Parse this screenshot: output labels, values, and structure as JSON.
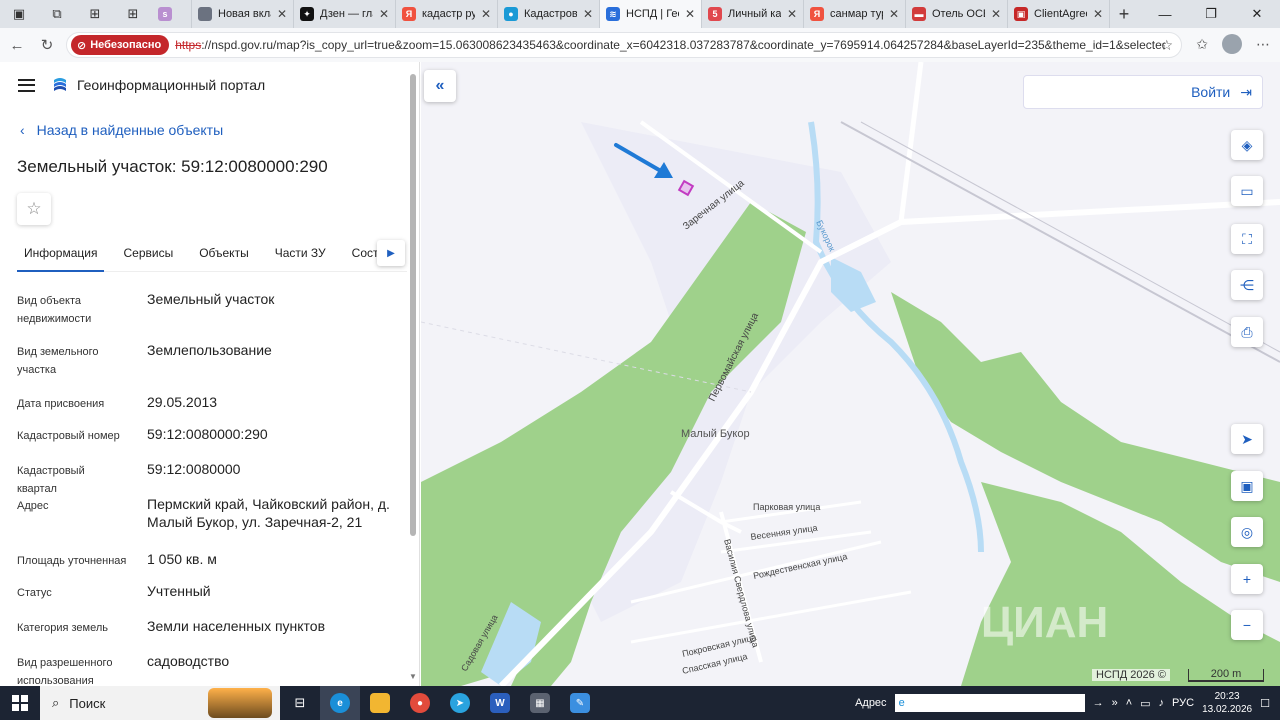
{
  "browser": {
    "tabs": [
      {
        "title": "",
        "favicon": "s",
        "color": "#b98fd0",
        "small": true
      },
      {
        "title": "Новая вкла",
        "favicon": "",
        "color": "#6b7280"
      },
      {
        "title": "Дзен — гла",
        "favicon": "✦",
        "color": "#111111"
      },
      {
        "title": "кадастр ру",
        "favicon": "Я",
        "color": "#f0523f"
      },
      {
        "title": "Кадастров",
        "favicon": "●",
        "color": "#1a9ad6"
      },
      {
        "title": "НСПД | Гео",
        "favicon": "≋",
        "color": "#2a6fdb",
        "active": true
      },
      {
        "title": "Личный ка",
        "favicon": "5",
        "color": "#e0484e"
      },
      {
        "title": "санмар тур",
        "favicon": "Я",
        "color": "#f0523f"
      },
      {
        "title": "Отель ОСЕ",
        "favicon": "▬",
        "color": "#d23b3b"
      },
      {
        "title": "ClientAgree",
        "favicon": "▣",
        "color": "#c62828"
      }
    ],
    "insecure_label": "Небезопасно",
    "url_scheme": "https",
    "url_rest": "://nspd.gov.ru/map?is_copy_url=true&zoom=15.063008623435463&coordinate_x=6042318.037283787&coordinate_y=7695914.064257284&baseLayerId=235&theme_id=1&selectedCa..."
  },
  "panel": {
    "portal_title": "Геоинформационный портал",
    "back_label": "Назад в найденные объекты",
    "object_title": "Земельный участок: 59:12:0080000:290",
    "tabs": [
      "Информация",
      "Сервисы",
      "Объекты",
      "Части ЗУ",
      "Соста"
    ],
    "rows": [
      {
        "key": "Вид объекта недвижимости",
        "value": "Земельный участок"
      },
      {
        "key": "Вид земельного участка",
        "value": "Землепользование"
      },
      {
        "key": "Дата присвоения",
        "value": "29.05.2013"
      },
      {
        "key": "Кадастровый номер",
        "value": "59:12:0080000:290"
      },
      {
        "key": "Кадастровый квартал",
        "value": "59:12:0080000"
      },
      {
        "key": "Адрес",
        "value": "Пермский край, Чайковский район, д. Малый Букор, ул. Заречная-2, 21"
      },
      {
        "key": "Площадь уточненная",
        "value": "1 050 кв. м"
      },
      {
        "key": "Статус",
        "value": "Учтенный"
      },
      {
        "key": "Категория земель",
        "value": "Земли населенных пунктов"
      },
      {
        "key": "Вид разрешенного использования",
        "value": "садоводство"
      }
    ]
  },
  "map": {
    "login_label": "Войти",
    "attribution": "НСПД 2026 ©",
    "scale_label": "200 m",
    "labels": {
      "village": "Малый Букор",
      "zarechnaya": "Заречная улица",
      "pervomayskaya": "Первомайская улица",
      "bukorok": "Букорок",
      "parkovaya": "Парковая улица",
      "vesennyaya": "Весенняя улица",
      "rozhdestvenskaya": "Рождественская улица",
      "sverdlova": "Василия Свердлова улица",
      "pokrovskaya": "Покровская улица",
      "spasskaya": "Спасская улица",
      "sadovaya": "Садовая улица",
      "watermark": "ЦИАН"
    },
    "colors": {
      "forest": "#9fd18b",
      "water": "#b8dcf5",
      "road": "#ffffff",
      "parcel": "#c23bc2",
      "arrow": "#1f7ad6"
    }
  },
  "taskbar": {
    "search_label": "Поиск",
    "address_label": "Адрес",
    "lang": "РУС",
    "time": "20:23",
    "date": "13.02.2026"
  }
}
